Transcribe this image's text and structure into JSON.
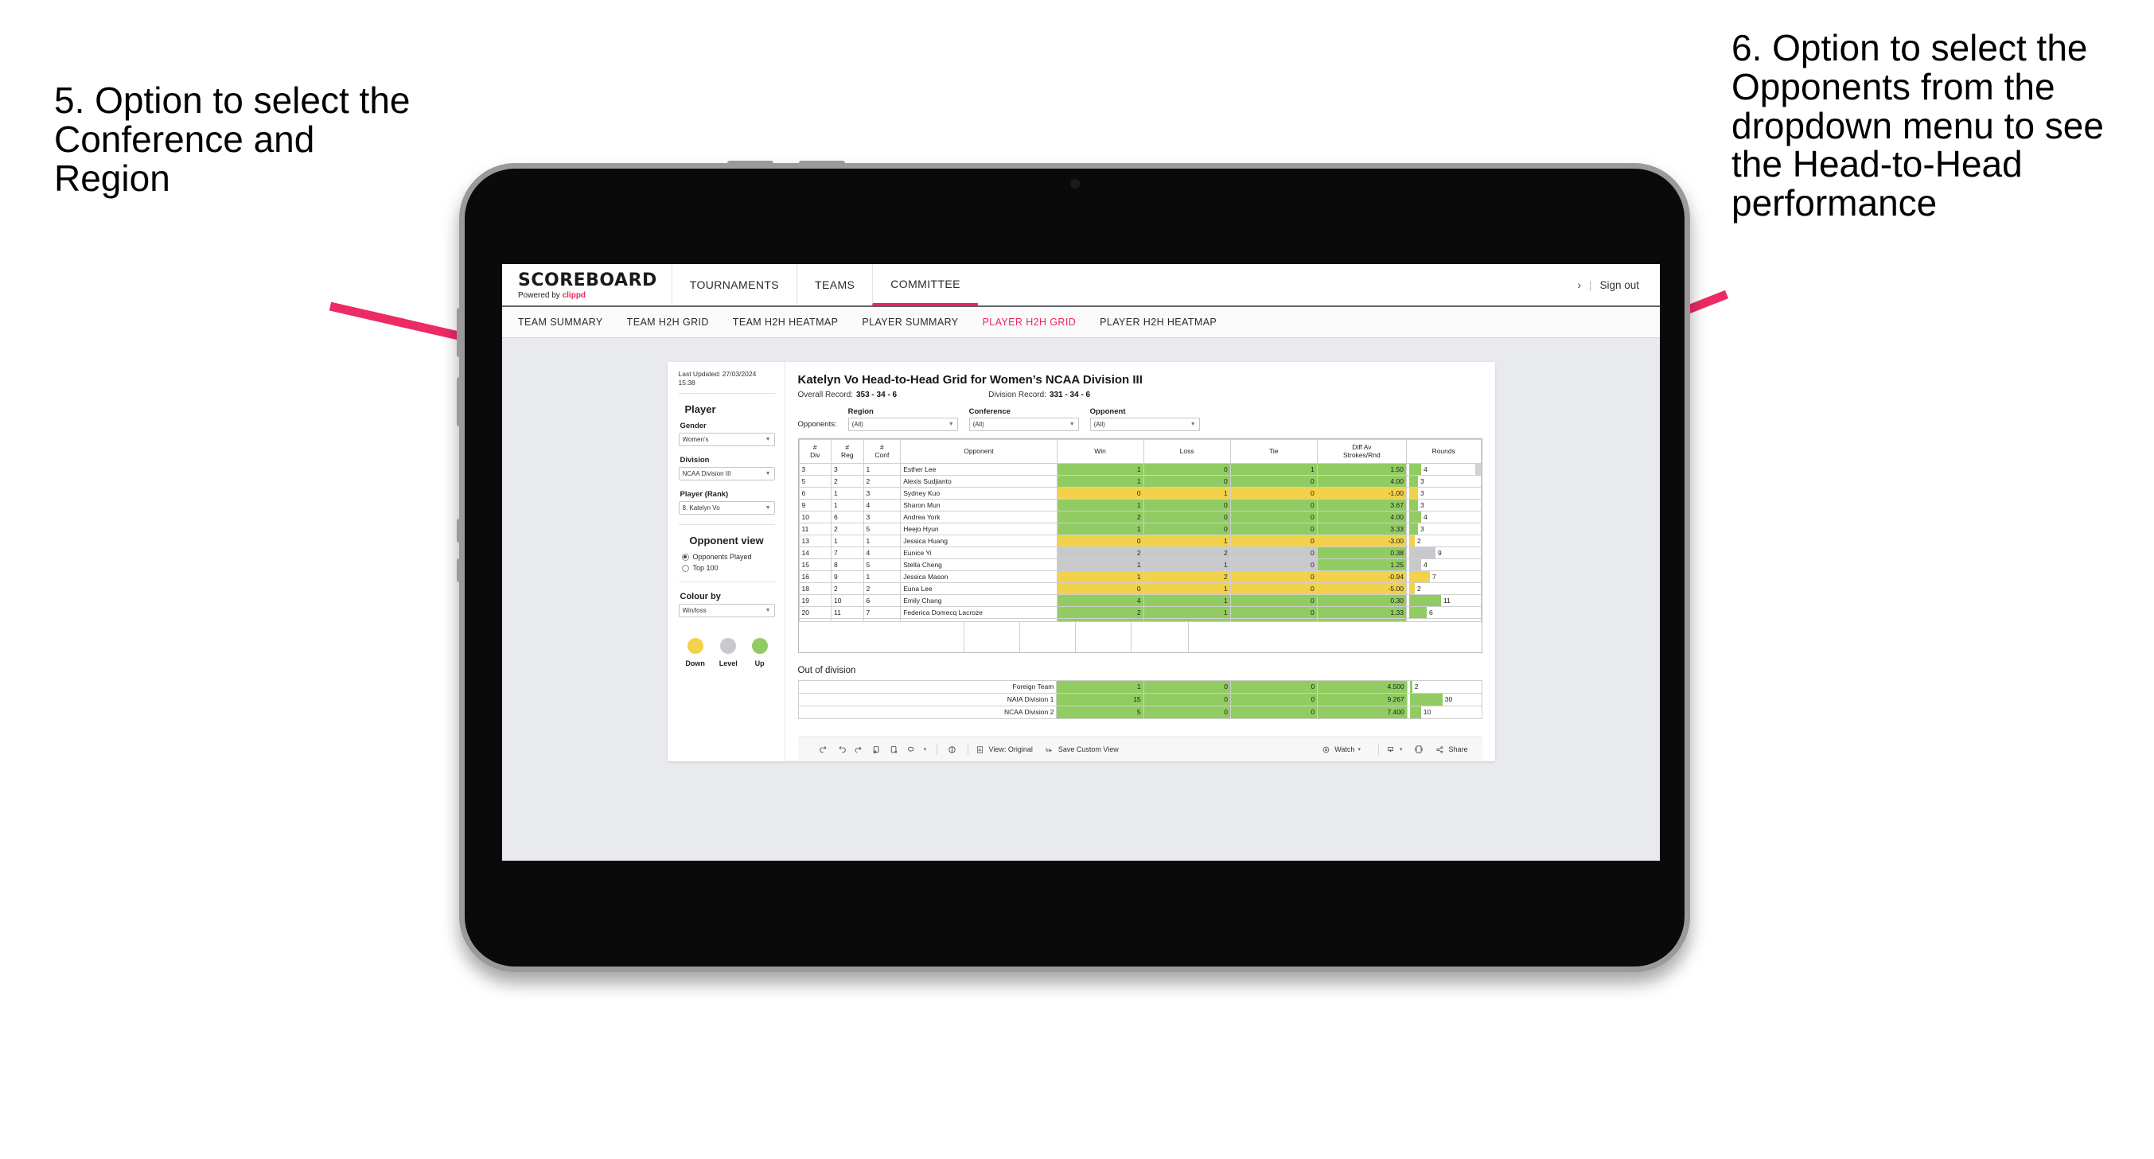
{
  "annotations": {
    "left": "5. Option to select the Conference and Region",
    "right": "6. Option to select the Opponents from the dropdown menu to see the Head-to-Head performance",
    "arrow_color": "#EC2A63"
  },
  "app": {
    "logo_main": "SCOREBOARD",
    "logo_sub_prefix": "Powered by ",
    "logo_brand": "clippd",
    "top_nav": [
      {
        "label": "TOURNAMENTS",
        "active": false
      },
      {
        "label": "TEAMS",
        "active": false
      },
      {
        "label": "COMMITTEE",
        "active": true
      }
    ],
    "top_right": {
      "chevron": "›",
      "separator": "|",
      "sign_out": "Sign out"
    },
    "sub_nav": [
      {
        "label": "TEAM SUMMARY",
        "active": false
      },
      {
        "label": "TEAM H2H GRID",
        "active": false
      },
      {
        "label": "TEAM H2H HEATMAP",
        "active": false
      },
      {
        "label": "PLAYER SUMMARY",
        "active": false
      },
      {
        "label": "PLAYER H2H GRID",
        "active": true
      },
      {
        "label": "PLAYER H2H HEATMAP",
        "active": false
      }
    ]
  },
  "sidebar": {
    "last_updated": "Last Updated: 27/03/2024 15:38",
    "player_heading": "Player",
    "gender": {
      "label": "Gender",
      "value": "Women’s"
    },
    "division": {
      "label": "Division",
      "value": "NCAA Division III"
    },
    "player_rank": {
      "label": "Player (Rank)",
      "value": "8. Katelyn Vo"
    },
    "opponent_view": {
      "heading": "Opponent view",
      "options": [
        {
          "label": "Opponents Played",
          "selected": true
        },
        {
          "label": "Top 100",
          "selected": false
        }
      ]
    },
    "colour_by": {
      "label": "Colour by",
      "value": "Win/loss"
    },
    "legend": [
      {
        "label": "Down",
        "color": "#F2D14B"
      },
      {
        "label": "Level",
        "color": "#C7C9CC"
      },
      {
        "label": "Up",
        "color": "#91CC63"
      }
    ]
  },
  "main": {
    "title": "Katelyn Vo Head-to-Head Grid for Women’s NCAA Division III",
    "overall_record": {
      "label": "Overall Record:",
      "value": "353 - 34 - 6"
    },
    "division_record": {
      "label": "Division Record:",
      "value": "331 - 34 - 6"
    },
    "opponents_label": "Opponents:",
    "filters": [
      {
        "label": "Region",
        "value": "(All)"
      },
      {
        "label": "Conference",
        "value": "(All)"
      },
      {
        "label": "Opponent",
        "value": "(All)"
      }
    ],
    "out_of_division_title": "Out of division"
  },
  "chart_data": {
    "type": "table",
    "title": "Katelyn Vo Head-to-Head Grid for Women’s NCAA Division III",
    "columns": [
      "# Div",
      "# Reg",
      "# Conf",
      "Opponent",
      "Win",
      "Loss",
      "Tie",
      "Diff Av Strokes/Rnd",
      "Rounds"
    ],
    "column_headers_multiline": [
      {
        "l1": "#",
        "l2": "Div"
      },
      {
        "l1": "#",
        "l2": "Reg"
      },
      {
        "l1": "#",
        "l2": "Conf"
      },
      {
        "l1": "Opponent",
        "l2": ""
      },
      {
        "l1": "Win",
        "l2": ""
      },
      {
        "l1": "Loss",
        "l2": ""
      },
      {
        "l1": "Tie",
        "l2": ""
      },
      {
        "l1": "Diff Av",
        "l2": "Strokes/Rnd"
      },
      {
        "l1": "Rounds",
        "l2": ""
      }
    ],
    "rounds_max": 12,
    "rows": [
      {
        "div": "3",
        "reg": "3",
        "conf": "1",
        "opponent": "Esther Lee",
        "win": "1",
        "loss": "0",
        "tie": "1",
        "diff": "1.50",
        "rounds": 4,
        "color": "#91CC63"
      },
      {
        "div": "5",
        "reg": "2",
        "conf": "2",
        "opponent": "Alexis Sudjianto",
        "win": "1",
        "loss": "0",
        "tie": "0",
        "diff": "4.00",
        "rounds": 3,
        "color": "#91CC63"
      },
      {
        "div": "6",
        "reg": "1",
        "conf": "3",
        "opponent": "Sydney Kuo",
        "win": "0",
        "loss": "1",
        "tie": "0",
        "diff": "-1.00",
        "rounds": 3,
        "color": "#F2D14B"
      },
      {
        "div": "9",
        "reg": "1",
        "conf": "4",
        "opponent": "Sharon Mun",
        "win": "1",
        "loss": "0",
        "tie": "0",
        "diff": "3.67",
        "rounds": 3,
        "color": "#91CC63"
      },
      {
        "div": "10",
        "reg": "6",
        "conf": "3",
        "opponent": "Andrea York",
        "win": "2",
        "loss": "0",
        "tie": "0",
        "diff": "4.00",
        "rounds": 4,
        "color": "#91CC63"
      },
      {
        "div": "11",
        "reg": "2",
        "conf": "5",
        "opponent": "Heejo Hyun",
        "win": "1",
        "loss": "0",
        "tie": "0",
        "diff": "3.33",
        "rounds": 3,
        "color": "#91CC63"
      },
      {
        "div": "13",
        "reg": "1",
        "conf": "1",
        "opponent": "Jessica Huang",
        "win": "0",
        "loss": "1",
        "tie": "0",
        "diff": "-3.00",
        "rounds": 2,
        "color": "#F2D14B"
      },
      {
        "div": "14",
        "reg": "7",
        "conf": "4",
        "opponent": "Eunice Yi",
        "win": "2",
        "loss": "2",
        "tie": "0",
        "diff": "0.38",
        "rounds": 9,
        "color": "#C7C9CC",
        "diff_color": "#91CC63"
      },
      {
        "div": "15",
        "reg": "8",
        "conf": "5",
        "opponent": "Stella Cheng",
        "win": "1",
        "loss": "1",
        "tie": "0",
        "diff": "1.25",
        "rounds": 4,
        "color": "#C7C9CC",
        "diff_color": "#91CC63"
      },
      {
        "div": "16",
        "reg": "9",
        "conf": "1",
        "opponent": "Jessica Mason",
        "win": "1",
        "loss": "2",
        "tie": "0",
        "diff": "-0.94",
        "rounds": 7,
        "color": "#F2D14B"
      },
      {
        "div": "18",
        "reg": "2",
        "conf": "2",
        "opponent": "Euna Lee",
        "win": "0",
        "loss": "1",
        "tie": "0",
        "diff": "-5.00",
        "rounds": 2,
        "color": "#F2D14B"
      },
      {
        "div": "19",
        "reg": "10",
        "conf": "6",
        "opponent": "Emily Chang",
        "win": "4",
        "loss": "1",
        "tie": "0",
        "diff": "0.30",
        "rounds": 11,
        "color": "#91CC63"
      },
      {
        "div": "20",
        "reg": "11",
        "conf": "7",
        "opponent": "Federica Domecq Lacroze",
        "win": "2",
        "loss": "1",
        "tie": "0",
        "diff": "1.33",
        "rounds": 6,
        "color": "#91CC63"
      }
    ],
    "out_of_division": {
      "title": "Out of division",
      "rounds_max": 32,
      "rows": [
        {
          "name": "Foreign Team",
          "win": "1",
          "loss": "0",
          "tie": "0",
          "diff": "4.500",
          "rounds": 2,
          "color": "#91CC63"
        },
        {
          "name": "NAIA Division 1",
          "win": "15",
          "loss": "0",
          "tie": "0",
          "diff": "9.267",
          "rounds": 30,
          "color": "#91CC63"
        },
        {
          "name": "NCAA Division 2",
          "win": "5",
          "loss": "0",
          "tie": "0",
          "diff": "7.400",
          "rounds": 10,
          "color": "#91CC63"
        }
      ]
    }
  },
  "toolbar": {
    "view_label": "View: Original",
    "save_label": "Save Custom View",
    "watch_label": "Watch",
    "share_label": "Share",
    "caret": "▾"
  }
}
